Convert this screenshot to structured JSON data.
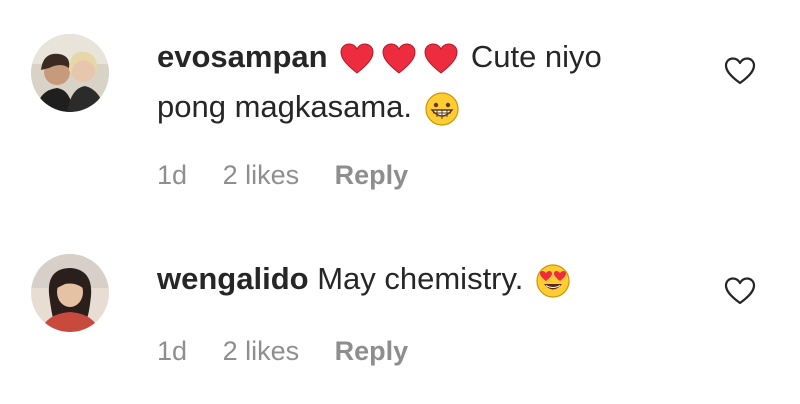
{
  "comments": [
    {
      "username": "evosampan",
      "text_line1": "Cute niyo",
      "text_line2": "pong magkasama.",
      "emojis": [
        "red-heart",
        "red-heart",
        "red-heart",
        "grinning-face"
      ],
      "time": "1d",
      "likes": "2 likes",
      "reply": "Reply"
    },
    {
      "username": "wengalido",
      "text": "May chemistry.",
      "emojis": [
        "heart-eyes-face"
      ],
      "time": "1d",
      "likes": "2 likes",
      "reply": "Reply"
    }
  ],
  "colors": {
    "text": "#262626",
    "meta": "#8e8e8e",
    "heart": "#ed2d3f",
    "emoji_face": "#ffcc33"
  }
}
